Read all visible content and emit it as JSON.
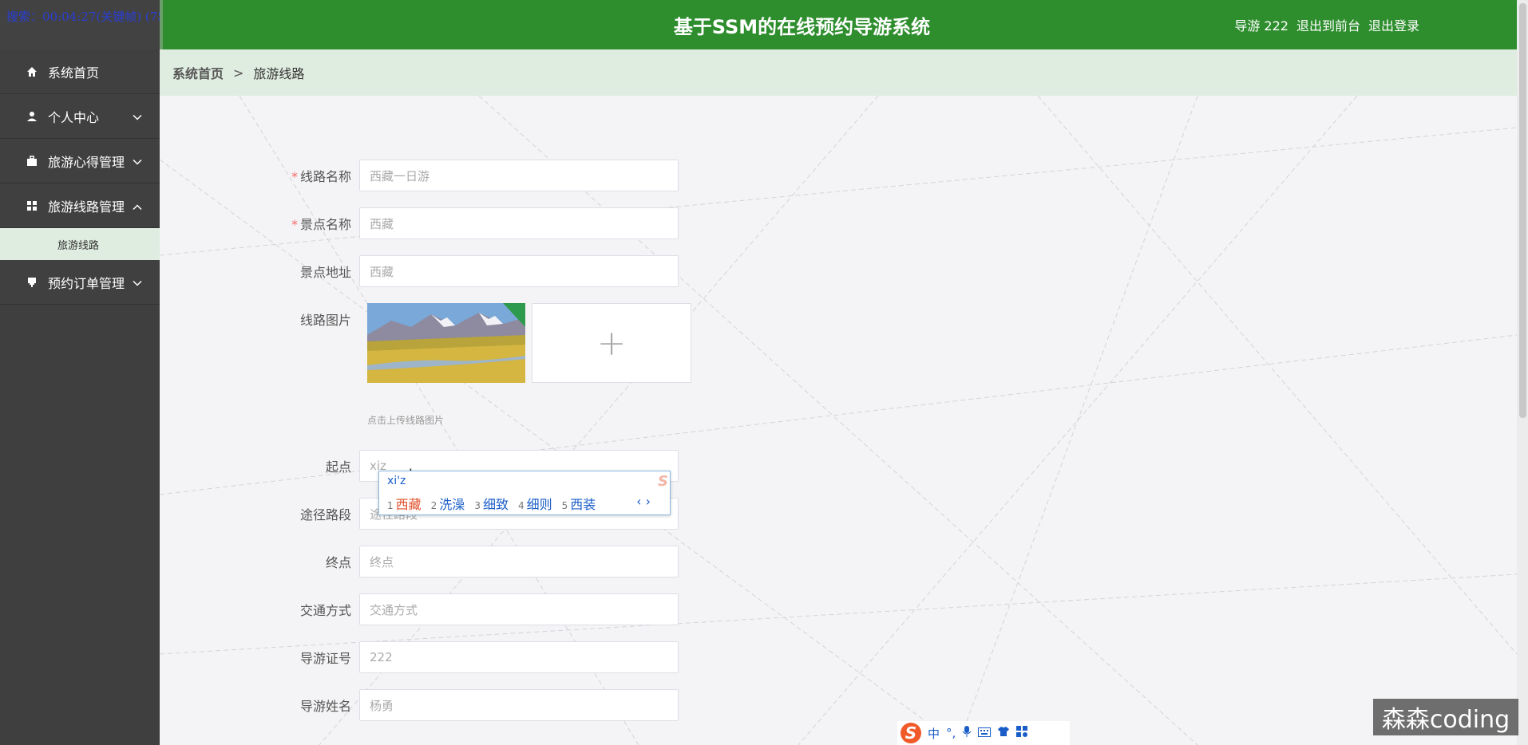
{
  "recording_overlay": "搜索：00:04:27(关键帧) (75%)",
  "header": {
    "title": "基于SSM的在线预约导游系统",
    "user": "导游 222",
    "to_front": "退出到前台",
    "logout": "退出登录"
  },
  "sidebar": {
    "items": [
      {
        "label": "系统首页",
        "icon": "home-icon"
      },
      {
        "label": "个人中心",
        "icon": "user-icon"
      },
      {
        "label": "旅游心得管理",
        "icon": "briefcase-icon"
      },
      {
        "label": "旅游线路管理",
        "icon": "grid-icon"
      },
      {
        "label": "预约订单管理",
        "icon": "stamp-icon"
      }
    ],
    "sub_items": [
      "旅游线路"
    ]
  },
  "breadcrumb": {
    "home": "系统首页",
    "separator": ">",
    "current": "旅游线路"
  },
  "form": {
    "route_name": {
      "label": "线路名称",
      "value": "西藏一日游",
      "required": true
    },
    "spot_name": {
      "label": "景点名称",
      "value": "西藏",
      "required": true
    },
    "spot_address": {
      "label": "景点地址",
      "value": "西藏"
    },
    "route_image": {
      "label": "线路图片",
      "hint": "点击上传线路图片",
      "add_symbol": "+"
    },
    "start": {
      "label": "起点",
      "value": "xiz"
    },
    "via": {
      "label": "途径路段",
      "value": "途径路段"
    },
    "end": {
      "label": "终点",
      "placeholder": "终点"
    },
    "transport": {
      "label": "交通方式",
      "placeholder": "交通方式"
    },
    "guide_license": {
      "label": "导游证号",
      "value": "222"
    },
    "guide_name": {
      "label": "导游姓名",
      "value": "杨勇"
    }
  },
  "ime": {
    "code": "xi'z",
    "candidates": [
      {
        "n": "1",
        "text": "西藏"
      },
      {
        "n": "2",
        "text": "洗澡"
      },
      {
        "n": "3",
        "text": "细致"
      },
      {
        "n": "4",
        "text": "细则"
      },
      {
        "n": "5",
        "text": "西装"
      }
    ],
    "pager": "‹ ›",
    "toolbar": {
      "logo": "S",
      "mode": "中",
      "punct": "°,",
      "mic": "🎤",
      "keyboard": "⌨",
      "skin": "👕",
      "apps": "▦"
    }
  },
  "watermark": "森森coding",
  "colors": {
    "header_green": "#2e8e2e",
    "sidebar": "#3f3f3f",
    "crumb_bg": "#dfece0",
    "required": "#f56c6c"
  }
}
